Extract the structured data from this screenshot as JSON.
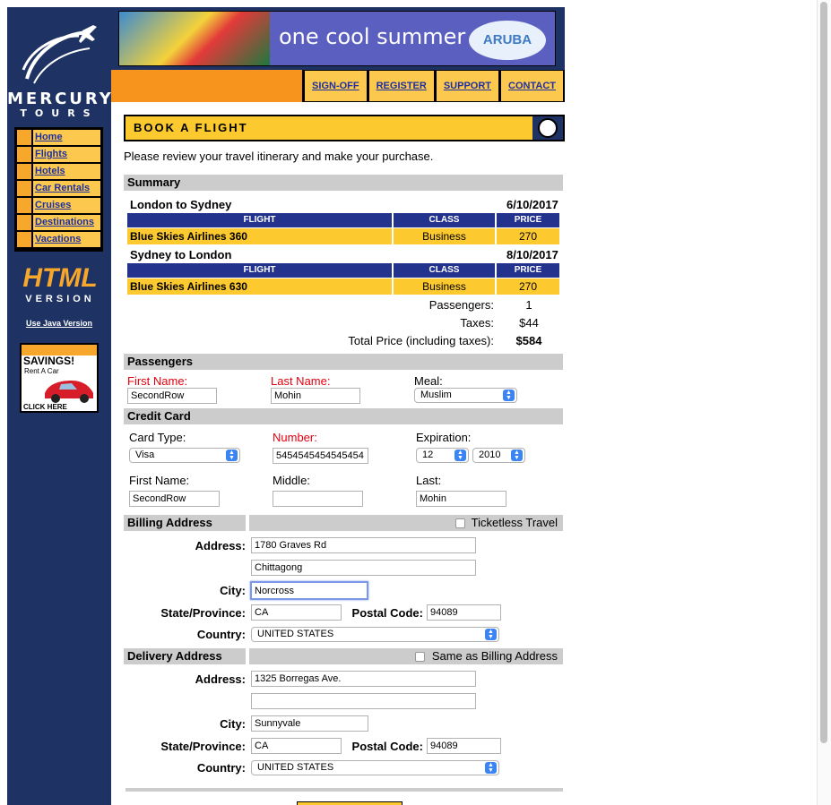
{
  "brand": {
    "line1": "MERCURY",
    "line2": "TOURS"
  },
  "sidebar": {
    "items": [
      {
        "label": "Home"
      },
      {
        "label": "Flights"
      },
      {
        "label": "Hotels"
      },
      {
        "label": "Car Rentals"
      },
      {
        "label": "Cruises"
      },
      {
        "label": "Destinations"
      },
      {
        "label": "Vacations"
      }
    ],
    "html_version": {
      "line1": "HTML",
      "line2": "VERSION"
    },
    "java_link": "Use Java Version",
    "ad": {
      "title": "SAVINGS!",
      "subtitle": "Rent A Car",
      "cta": "CLICK HERE"
    }
  },
  "banner": {
    "text": "one cool summer",
    "badge": "ARUBA"
  },
  "topnav": [
    {
      "label": "SIGN-OFF"
    },
    {
      "label": "REGISTER"
    },
    {
      "label": "SUPPORT"
    },
    {
      "label": "CONTACT"
    }
  ],
  "page": {
    "title": "BOOK A FLIGHT",
    "intro": "Please review your travel itinerary and make your purchase."
  },
  "summary": {
    "heading": "Summary",
    "legs": [
      {
        "route": "London to Sydney",
        "date": "6/10/2017",
        "flight": "Blue Skies Airlines 360",
        "class": "Business",
        "price": "270"
      },
      {
        "route": "Sydney to London",
        "date": "8/10/2017",
        "flight": "Blue Skies Airlines 630",
        "class": "Business",
        "price": "270"
      }
    ],
    "columns": {
      "flight": "FLIGHT",
      "class": "CLASS",
      "price": "PRICE"
    },
    "passengers_label": "Passengers:",
    "passengers_value": "1",
    "taxes_label": "Taxes:",
    "taxes_value": "$44",
    "total_label": "Total Price (including taxes):",
    "total_value": "$584"
  },
  "passengers": {
    "heading": "Passengers",
    "first_label": "First Name:",
    "first_value": "SecondRow",
    "last_label": "Last Name:",
    "last_value": "Mohin",
    "meal_label": "Meal:",
    "meal_value": "Muslim"
  },
  "credit": {
    "heading": "Credit Card",
    "type_label": "Card Type:",
    "type_value": "Visa",
    "number_label": "Number:",
    "number_value": "5454545454545454",
    "exp_label": "Expiration:",
    "exp_month": "12",
    "exp_year": "2010",
    "first_label": "First Name:",
    "first_value": "SecondRow",
    "middle_label": "Middle:",
    "middle_value": "",
    "last_label": "Last:",
    "last_value": "Mohin"
  },
  "billing": {
    "heading": "Billing Address",
    "ticketless_label": "Ticketless Travel",
    "address_label": "Address:",
    "address1": "1780 Graves Rd",
    "address2": "Chittagong",
    "city_label": "City:",
    "city": "Norcross",
    "state_label": "State/Province:",
    "state": "CA",
    "postal_label": "Postal Code:",
    "postal": "94089",
    "country_label": "Country:",
    "country": "UNITED STATES"
  },
  "delivery": {
    "heading": "Delivery Address",
    "same_label": "Same as Billing Address",
    "address_label": "Address:",
    "address1": "1325 Borregas Ave.",
    "address2": "",
    "city_label": "City:",
    "city": "Sunnyvale",
    "state_label": "State/Province:",
    "state": "CA",
    "postal_label": "Postal Code:",
    "postal": "94089",
    "country_label": "Country:",
    "country": "UNITED STATES"
  }
}
